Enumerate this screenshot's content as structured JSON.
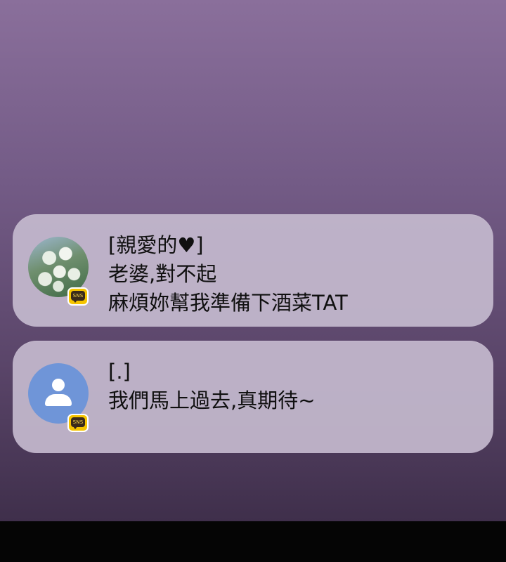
{
  "notifications": [
    {
      "avatar_icon": "flower-bouquet-avatar",
      "badge_label": "SNS",
      "sender": "[親愛的♥]",
      "lines": [
        "老婆,對不起",
        "麻煩妳幫我準備下酒菜TAT"
      ]
    },
    {
      "avatar_icon": "default-person-avatar",
      "badge_label": "SNS",
      "sender": "[.]",
      "lines": [
        "我們馬上過去,真期待~"
      ]
    }
  ],
  "colors": {
    "background_top": "#8a6f9b",
    "background_bottom": "#3f2f4b",
    "card": "#c4bace",
    "badge": "#f5c400",
    "default_avatar": "#6f95d8"
  }
}
